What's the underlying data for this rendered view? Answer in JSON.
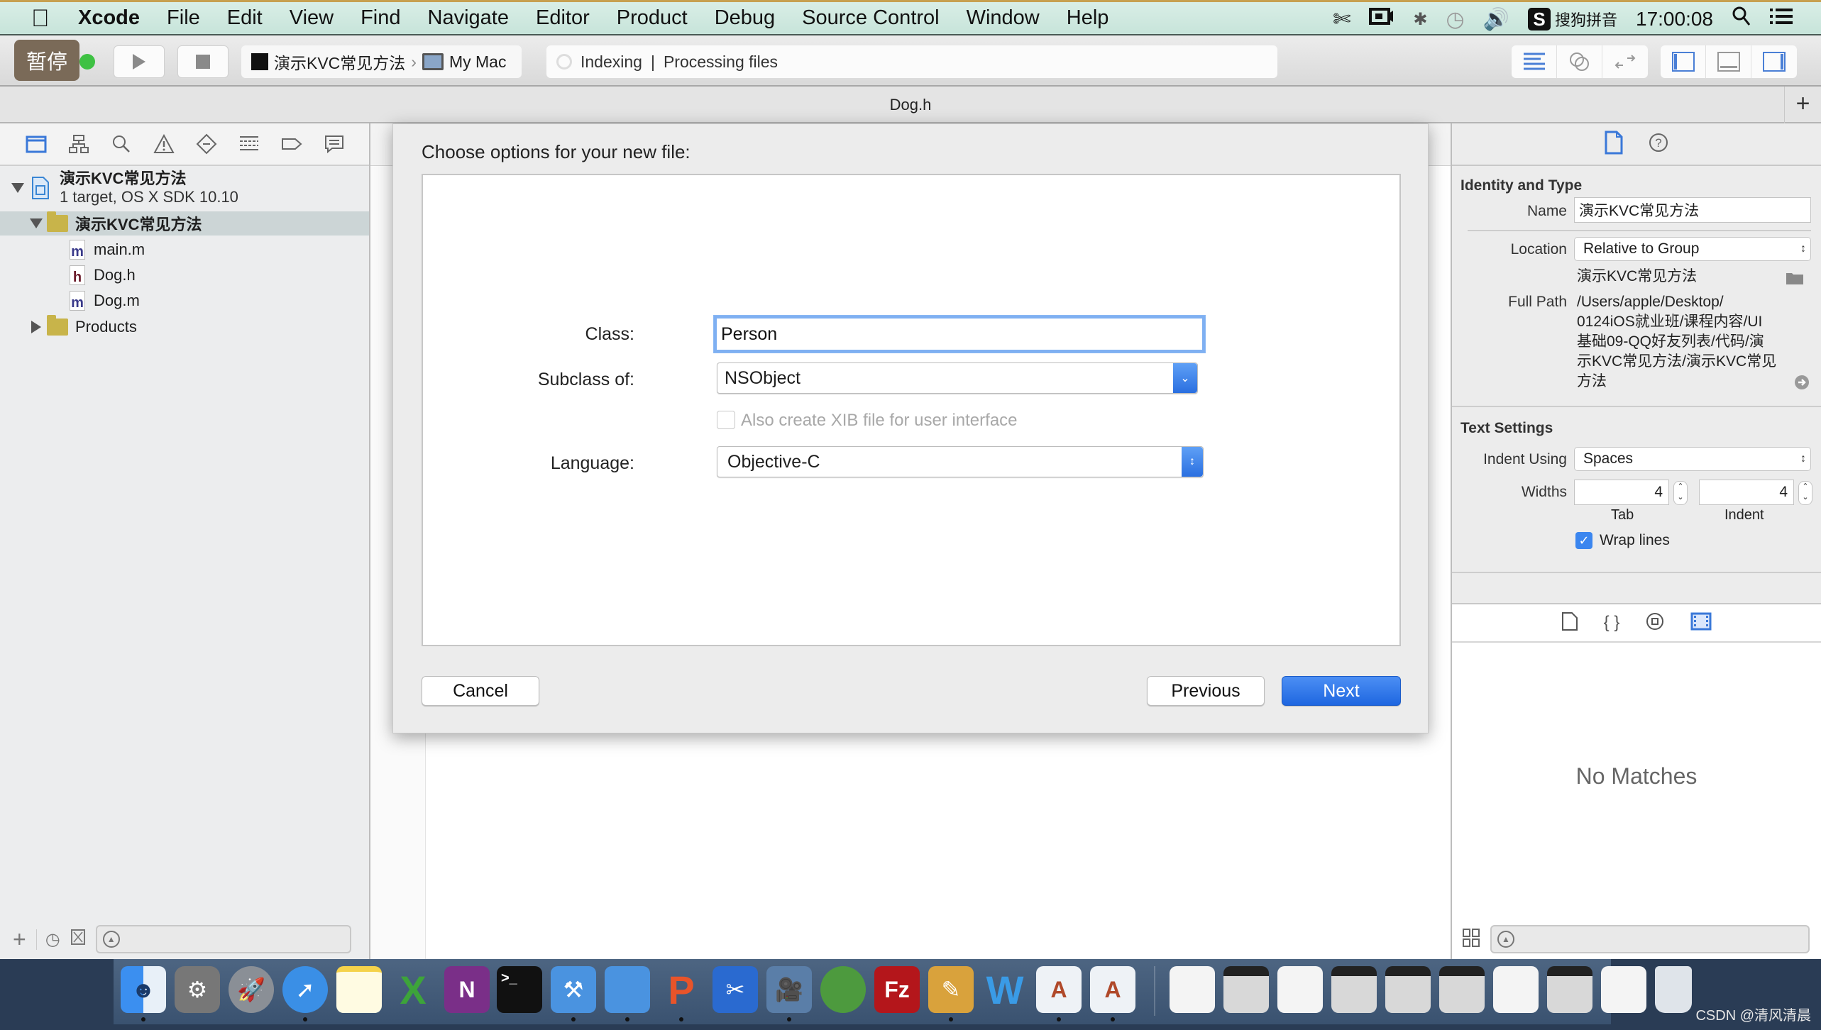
{
  "menubar": {
    "app_name": "Xcode",
    "items": [
      "File",
      "Edit",
      "View",
      "Find",
      "Navigate",
      "Editor",
      "Product",
      "Debug",
      "Source Control",
      "Window",
      "Help"
    ],
    "input_method": "搜狗拼音",
    "clock": "17:00:08"
  },
  "toolbar": {
    "pause_label": "暂停",
    "scheme_name": "演示KVC常见方法",
    "scheme_separator": "›",
    "destination": "My Mac",
    "activity_status": "Indexing",
    "activity_separator": "|",
    "activity_detail": "Processing files"
  },
  "editor": {
    "tab_title": "Dog.h",
    "add_tab_label": "+"
  },
  "navigator": {
    "project": {
      "name": "演示KVC常见方法",
      "subtitle": "1 target, OS X SDK 10.10"
    },
    "group": {
      "name": "演示KVC常见方法",
      "selected": true
    },
    "files": [
      {
        "name": "main.m",
        "type": "m"
      },
      {
        "name": "Dog.h",
        "type": "h"
      },
      {
        "name": "Dog.m",
        "type": "m"
      }
    ],
    "products": {
      "name": "Products"
    },
    "bottom": {
      "add_label": "+"
    }
  },
  "dialog": {
    "title": "Choose options for your new file:",
    "class_label": "Class:",
    "class_value": "Person",
    "subclass_label": "Subclass of:",
    "subclass_value": "NSObject",
    "xib_checkbox_label": "Also create XIB file for user interface",
    "xib_checked": false,
    "language_label": "Language:",
    "language_value": "Objective-C",
    "cancel_label": "Cancel",
    "previous_label": "Previous",
    "next_label": "Next"
  },
  "inspector": {
    "identity_title": "Identity and Type",
    "name_label": "Name",
    "name_value": "演示KVC常见方法",
    "location_label": "Location",
    "location_value": "Relative to Group",
    "location_folder": "演示KVC常见方法",
    "full_path_label": "Full Path",
    "full_path_lines": [
      "/Users/apple/Desktop/",
      "0124iOS就业班/课程内容/UI",
      "基础09-QQ好友列表/代码/演",
      "示KVC常见方法/演示KVC常见",
      "方法"
    ],
    "text_settings_title": "Text Settings",
    "indent_using_label": "Indent Using",
    "indent_using_value": "Spaces",
    "widths_label": "Widths",
    "tab_width": "4",
    "indent_width": "4",
    "tab_caption": "Tab",
    "indent_caption": "Indent",
    "wrap_lines_label": "Wrap lines",
    "wrap_lines_checked": true,
    "library_empty": "No Matches"
  },
  "dock": {
    "apps": [
      "Finder",
      "System Preferences",
      "Launchpad",
      "Safari",
      "Notes",
      "Excel",
      "OneNote",
      "Terminal",
      "Xcode",
      "Simulator",
      "WPS",
      "Screenshot",
      "Video Player",
      "Filezilla-like FTP",
      "FileZilla",
      "Instruments",
      "Word",
      "Preview Doc 1",
      "Preview Doc 2"
    ],
    "watermark": "CSDN @清风清晨"
  }
}
